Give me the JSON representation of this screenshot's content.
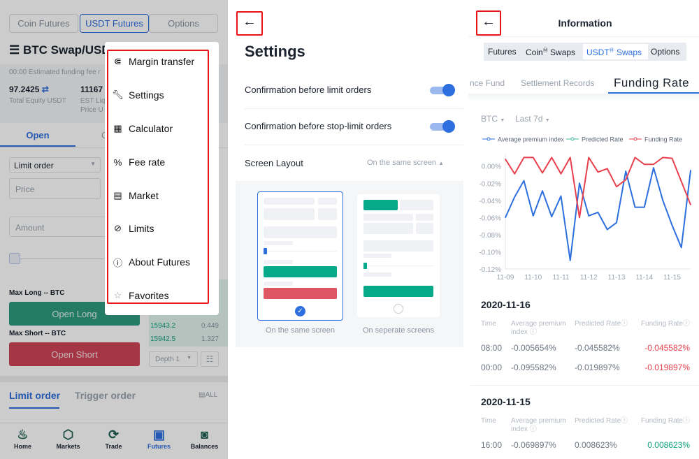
{
  "left": {
    "tabs": [
      "Coin Futures",
      "USDT Futures",
      "Options"
    ],
    "active_tab": 1,
    "pair_title": "BTC Swap/USDT",
    "funding_note": "00:00 Estimated funding fee r",
    "equity_value": "97.2425",
    "equity_label": "Total Equity USDT",
    "liq_value": "11167",
    "liq_label_1": "EST Liq",
    "liq_label_2": "Price U",
    "trade_tabs": [
      "Open",
      "C"
    ],
    "order_type": "Limit order",
    "price_placeholder": "Price",
    "amount_placeholder": "Amount",
    "max_long": "Max Long -- BTC",
    "open_long": "Open Long",
    "max_short": "Max Short -- BTC",
    "open_short": "Open Short",
    "orderbook": [
      {
        "price": "15943.2",
        "qty": "0.449"
      },
      {
        "price": "15942.5",
        "qty": "1.327"
      }
    ],
    "depth": "Depth 1",
    "order_tabs": [
      "Limit order",
      "Trigger order"
    ],
    "all_label": "ALL",
    "nav": [
      {
        "label": "Home",
        "icon": "flame-icon"
      },
      {
        "label": "Markets",
        "icon": "markets-icon"
      },
      {
        "label": "Trade",
        "icon": "trade-icon"
      },
      {
        "label": "Futures",
        "icon": "futures-icon"
      },
      {
        "label": "Balances",
        "icon": "wallet-icon"
      }
    ],
    "active_nav": 3,
    "menu": [
      {
        "label": "Margin transfer",
        "icon": "margin-transfer-icon"
      },
      {
        "label": "Settings",
        "icon": "wrench-icon"
      },
      {
        "label": "Calculator",
        "icon": "calculator-icon"
      },
      {
        "label": "Fee rate",
        "icon": "percent-icon"
      },
      {
        "label": "Market",
        "icon": "market-icon"
      },
      {
        "label": "Limits",
        "icon": "limits-icon"
      },
      {
        "label": "About Futures",
        "icon": "info-icon"
      },
      {
        "label": "Favorites",
        "icon": "star-icon"
      }
    ]
  },
  "settings": {
    "title": "Settings",
    "rows": [
      {
        "label": "Confirmation before limit orders",
        "on": true
      },
      {
        "label": "Confirmation before stop-limit orders",
        "on": true
      }
    ],
    "layout_label": "Screen Layout",
    "layout_value": "On the same screen",
    "options": [
      {
        "label": "On the same screen",
        "selected": true
      },
      {
        "label": "On seperate screens",
        "selected": false
      }
    ]
  },
  "info": {
    "title": "Information",
    "segments": [
      "Futures",
      "Coin",
      "Swaps",
      "USDT",
      "Swaps",
      "Options"
    ],
    "tabs": [
      "nce Fund",
      "Settlement Records",
      "Funding Rate"
    ],
    "coin": "BTC",
    "range": "Last 7d",
    "sections": [
      {
        "date": "2020-11-16",
        "rows": [
          {
            "time": "08:00",
            "avg": "-0.005654%",
            "pred": "-0.045582%",
            "fund": "-0.045582%"
          },
          {
            "time": "00:00",
            "avg": "-0.095582%",
            "pred": "-0.019897%",
            "fund": "-0.019897%"
          }
        ]
      },
      {
        "date": "2020-11-15",
        "rows": [
          {
            "time": "16:00",
            "avg": "-0.069897%",
            "pred": "0.008623%",
            "fund": "0.008623%"
          }
        ]
      }
    ],
    "headers": {
      "time": "Time",
      "avg1": "Average premium",
      "avg2": "index",
      "pred": "Predicted Rate",
      "fund": "Funding Rate"
    },
    "colors": {
      "negative": "#e8414e",
      "positive": "#0fa37f"
    }
  },
  "chart_data": {
    "type": "line",
    "legend": [
      "Average premium index",
      "Predicted Rate",
      "Funding Rate"
    ],
    "legend_position": "top",
    "x_ticks": [
      "11-09",
      "11-10",
      "11-11",
      "11-12",
      "11-13",
      "11-14",
      "11-15"
    ],
    "y_ticks": [
      "0.00%",
      "-0.02%",
      "-0.04%",
      "-0.06%",
      "-0.08%",
      "-0.10%",
      "-0.12%"
    ],
    "ylim": [
      -0.12,
      0.015
    ],
    "series": [
      {
        "name": "Average premium index",
        "color": "#2d6fdf",
        "values": [
          -0.06,
          -0.036,
          -0.017,
          -0.058,
          -0.029,
          -0.059,
          -0.035,
          -0.11,
          -0.02,
          -0.058,
          -0.054,
          -0.074,
          -0.066,
          -0.006,
          -0.048,
          -0.048,
          -0.002,
          -0.04,
          -0.069,
          -0.095,
          -0.005
        ]
      },
      {
        "name": "Predicted Rate",
        "color": "#3cb89a",
        "values": []
      },
      {
        "name": "Funding Rate",
        "color": "#e8414e",
        "values": [
          0.008,
          -0.009,
          0.01,
          0.01,
          -0.008,
          0.01,
          -0.009,
          0.01,
          -0.06,
          0.01,
          -0.007,
          -0.003,
          -0.024,
          -0.016,
          0.01,
          0.002,
          0.002,
          0.01,
          0.009,
          -0.018,
          -0.045
        ]
      }
    ]
  }
}
